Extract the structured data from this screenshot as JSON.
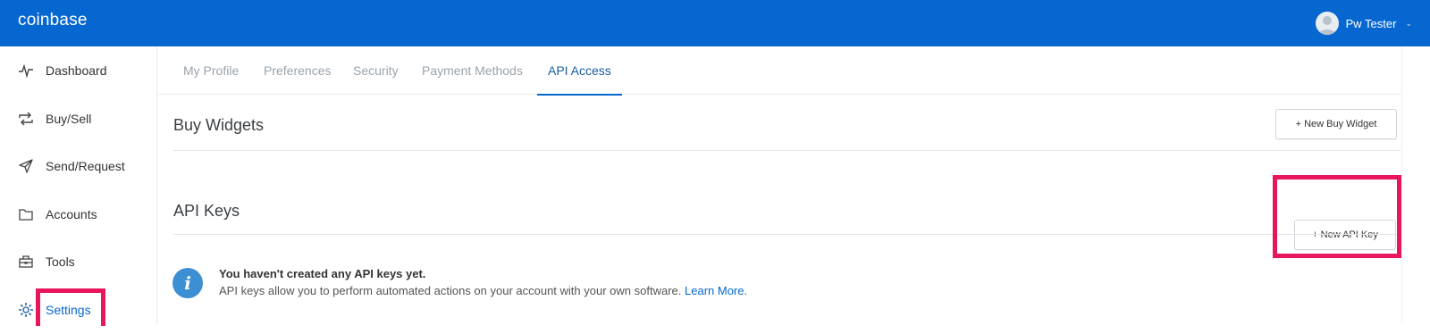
{
  "app": {
    "logo_text": "coinbase"
  },
  "user": {
    "name": "Pw Tester",
    "avatar_icon": "person-avatar-icon",
    "menu_icon": "chevron-down-icon"
  },
  "sidebar": {
    "items": [
      {
        "label": "Dashboard",
        "icon": "activity-pulse-icon"
      },
      {
        "label": "Buy/Sell",
        "icon": "swap-arrows-icon"
      },
      {
        "label": "Send/Request",
        "icon": "paper-plane-icon"
      },
      {
        "label": "Accounts",
        "icon": "wallet-icon"
      },
      {
        "label": "Tools",
        "icon": "toolbox-icon"
      },
      {
        "label": "Settings",
        "icon": "gear-icon",
        "active": true
      }
    ]
  },
  "tabs": [
    {
      "label": "My Profile"
    },
    {
      "label": "Preferences"
    },
    {
      "label": "Security"
    },
    {
      "label": "Payment Methods"
    },
    {
      "label": "API Access",
      "active": true
    }
  ],
  "sections": {
    "buy_widgets": {
      "title": "Buy Widgets",
      "button": "+ New Buy Widget"
    },
    "api_keys": {
      "title": "API Keys",
      "button": "+ New API Key"
    }
  },
  "notice": {
    "icon": "info-icon",
    "title": "You haven't created any API keys yet.",
    "text": "API keys allow you to perform automated actions on your account with your own software.",
    "link": "Learn More."
  },
  "colors": {
    "brand": "#0667d0",
    "highlight": "#e8175d",
    "info": "#3d8fd4"
  }
}
